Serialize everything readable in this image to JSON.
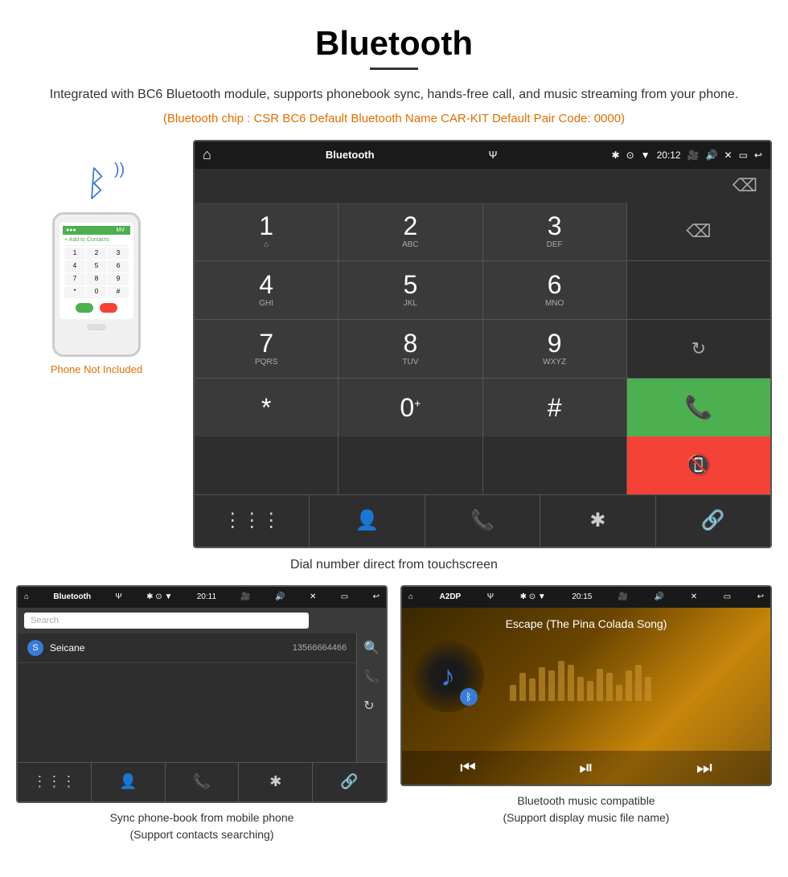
{
  "header": {
    "title": "Bluetooth",
    "underline": true,
    "subtitle": "Integrated with BC6 Bluetooth module, supports phonebook sync, hands-free call, and music streaming from your phone.",
    "bt_info": "(Bluetooth chip : CSR BC6    Default Bluetooth Name CAR-KIT    Default Pair Code: 0000)"
  },
  "keypad_screen": {
    "status_bar": {
      "app_name": "Bluetooth",
      "time": "20:12",
      "icons": [
        "bt",
        "location",
        "signal",
        "camera",
        "volume",
        "close",
        "screen",
        "back"
      ]
    },
    "keys": [
      {
        "main": "1",
        "sub": "⌂"
      },
      {
        "main": "2",
        "sub": "ABC"
      },
      {
        "main": "3",
        "sub": "DEF"
      },
      {
        "main": "",
        "sub": "",
        "type": "empty"
      },
      {
        "main": "4",
        "sub": "GHI"
      },
      {
        "main": "5",
        "sub": "JKL"
      },
      {
        "main": "6",
        "sub": "MNO"
      },
      {
        "main": "",
        "sub": "",
        "type": "empty"
      },
      {
        "main": "7",
        "sub": "PQRS"
      },
      {
        "main": "8",
        "sub": "TUV"
      },
      {
        "main": "9",
        "sub": "WXYZ"
      },
      {
        "main": "↻",
        "sub": "",
        "type": "refresh"
      },
      {
        "main": "*",
        "sub": ""
      },
      {
        "main": "0",
        "sub": "+"
      },
      {
        "main": "#",
        "sub": ""
      },
      {
        "main": "📞",
        "sub": "",
        "type": "call-green"
      },
      {
        "main": "📵",
        "sub": "",
        "type": "call-red"
      }
    ],
    "nav_items": [
      "⋮⋮⋮",
      "👤",
      "📞",
      "✱",
      "🔗"
    ],
    "backspace": "⌫"
  },
  "caption_dial": "Dial number direct from touchscreen",
  "phonebook_screen": {
    "status_bar": {
      "app_name": "Bluetooth",
      "time": "20:11"
    },
    "search_placeholder": "Search",
    "contacts": [
      {
        "letter": "S",
        "name": "Seicane",
        "number": "13566664466"
      }
    ],
    "side_icons": [
      "🔍",
      "📞",
      "↻"
    ],
    "nav_items": [
      "⋮⋮⋮",
      "👤",
      "📞",
      "✱",
      "🔗"
    ]
  },
  "music_screen": {
    "status_bar": {
      "app_name": "A2DP",
      "time": "20:15"
    },
    "track_title": "Escape (The Pina Colada Song)",
    "eq_bars": [
      20,
      35,
      28,
      42,
      38,
      50,
      45,
      30,
      25,
      40,
      35,
      20,
      38,
      45,
      30
    ],
    "controls": [
      "⏮",
      "⏯",
      "⏭"
    ]
  },
  "phone_not_included": "Phone Not Included",
  "caption_phonebook": "Sync phone-book from mobile phone\n(Support contacts searching)",
  "caption_music": "Bluetooth music compatible\n(Support display music file name)"
}
